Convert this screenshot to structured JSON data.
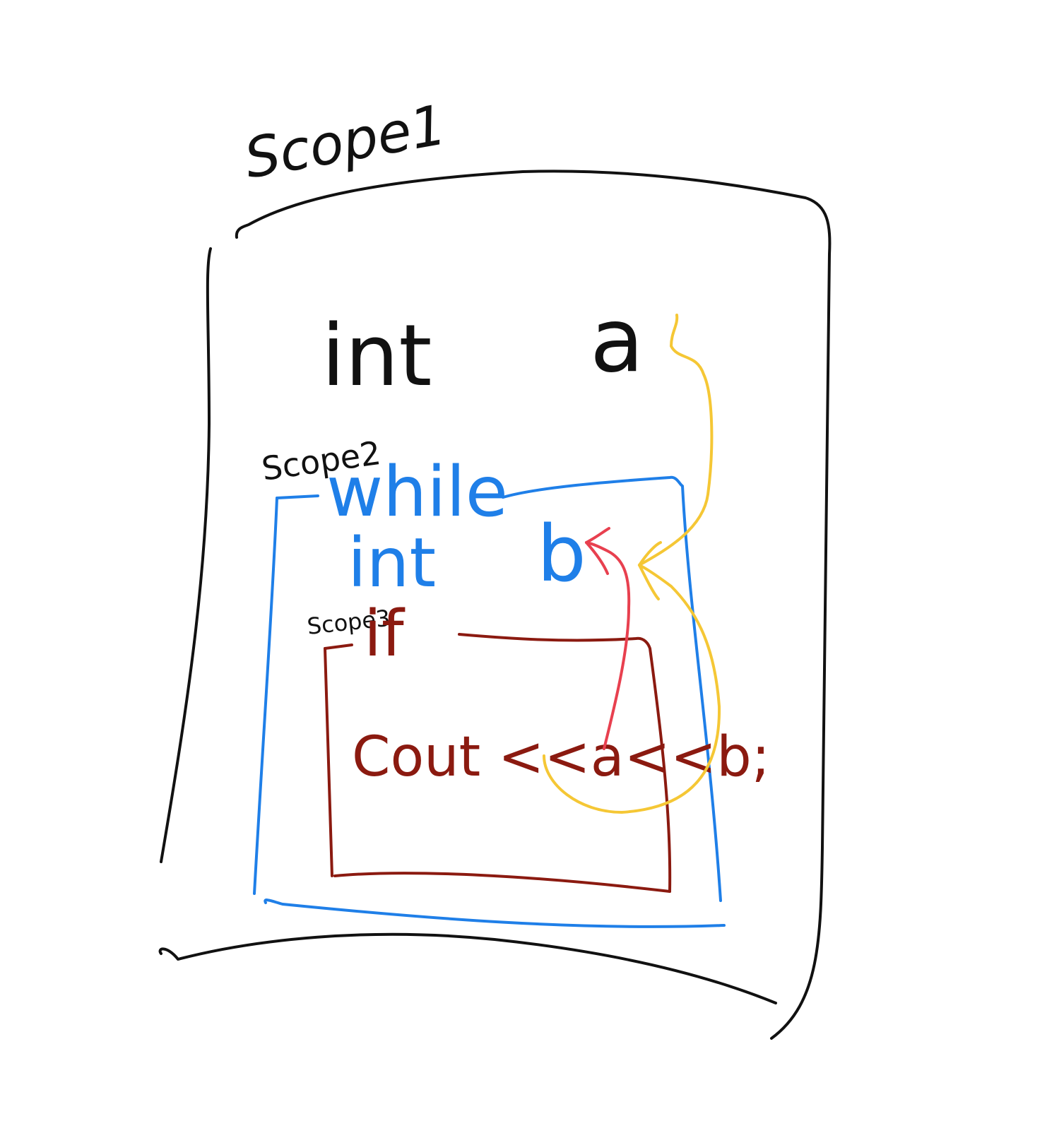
{
  "colors": {
    "scope1": "#111111",
    "scope2": "#1f7fe8",
    "scope3": "#8b1a10",
    "arrow_a": "#f5c735",
    "arrow_b": "#e8404f",
    "background": "#ffffff"
  },
  "scope1": {
    "label": "Scope1",
    "type_keyword": "int",
    "variable": "a"
  },
  "scope2": {
    "label": "Scope2",
    "keyword": "while",
    "type_keyword": "int",
    "variable": "b"
  },
  "scope3": {
    "label": "Scope3",
    "keyword": "if",
    "statement": "Cout <<a<<b;"
  }
}
